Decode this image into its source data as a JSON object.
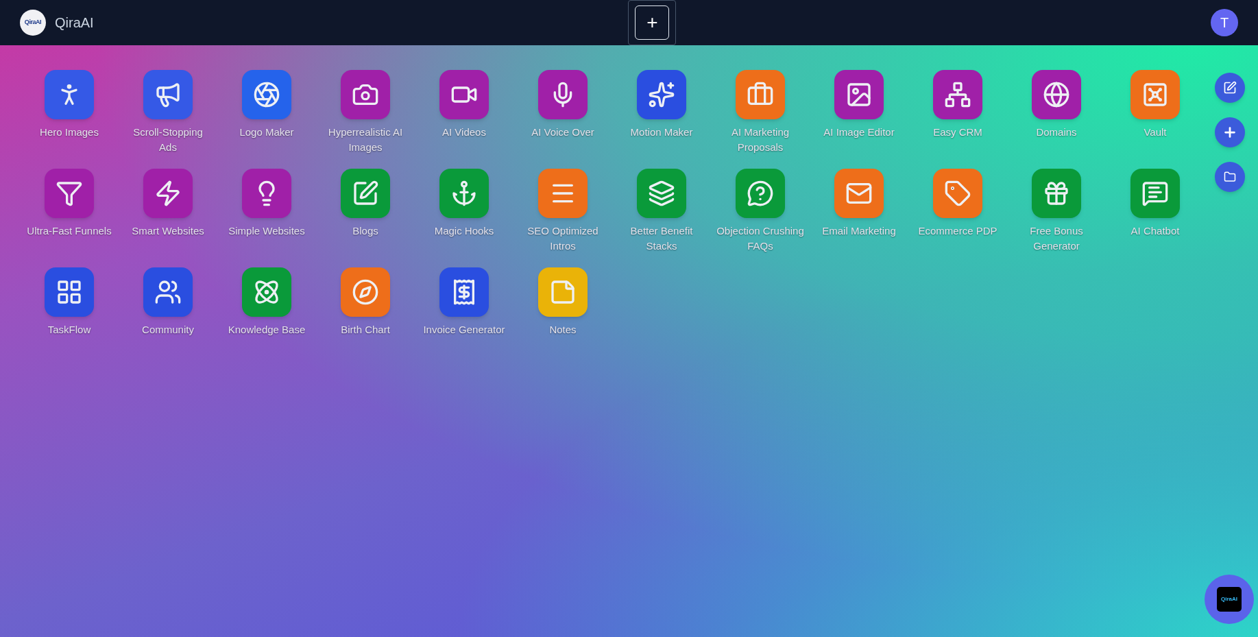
{
  "header": {
    "logo_text": "QiraAI",
    "brand": "QiraAI",
    "new_button": "+",
    "avatar": "T"
  },
  "apps": [
    {
      "label": "Hero Images",
      "color": "#3559e6"
    },
    {
      "label": "Scroll-Stopping Ads",
      "color": "#3559e6"
    },
    {
      "label": "Logo Maker",
      "color": "#2563eb"
    },
    {
      "label": "Hyperrealistic AI Images",
      "color": "#a020a8"
    },
    {
      "label": "AI Videos",
      "color": "#a020a8"
    },
    {
      "label": "AI Voice Over",
      "color": "#a020a8"
    },
    {
      "label": "Motion Maker",
      "color": "#2a4ee0"
    },
    {
      "label": "AI Marketing Proposals",
      "color": "#ee6e1a"
    },
    {
      "label": "AI Image Editor",
      "color": "#a020a8"
    },
    {
      "label": "Easy CRM",
      "color": "#a020a8"
    },
    {
      "label": "Domains",
      "color": "#a020a8"
    },
    {
      "label": "Vault",
      "color": "#ee6e1a"
    },
    {
      "label": "Ultra-Fast Funnels",
      "color": "#a020a8"
    },
    {
      "label": "Smart Websites",
      "color": "#a020a8"
    },
    {
      "label": "Simple Websites",
      "color": "#a020a8"
    },
    {
      "label": "Blogs",
      "color": "#0a9a3a"
    },
    {
      "label": "Magic Hooks",
      "color": "#0a9a3a"
    },
    {
      "label": "SEO Optimized Intros",
      "color": "#ee6e1a"
    },
    {
      "label": "Better Benefit Stacks",
      "color": "#0a9a3a"
    },
    {
      "label": "Objection Crushing FAQs",
      "color": "#0a9a3a"
    },
    {
      "label": "Email Marketing",
      "color": "#ee6e1a"
    },
    {
      "label": "Ecommerce PDP",
      "color": "#ee6e1a"
    },
    {
      "label": "Free Bonus Generator",
      "color": "#0a9a3a"
    },
    {
      "label": "AI Chatbot",
      "color": "#0a9a3a"
    },
    {
      "label": "TaskFlow",
      "color": "#2a4ee0"
    },
    {
      "label": "Community",
      "color": "#2a4ee0"
    },
    {
      "label": "Knowledge Base",
      "color": "#0a9a3a"
    },
    {
      "label": "Birth Chart",
      "color": "#ee6e1a"
    },
    {
      "label": "Invoice Generator",
      "color": "#2a4ee0"
    },
    {
      "label": "Notes",
      "color": "#eab308"
    }
  ],
  "assistant": {
    "logo_text": "QiraAI"
  }
}
